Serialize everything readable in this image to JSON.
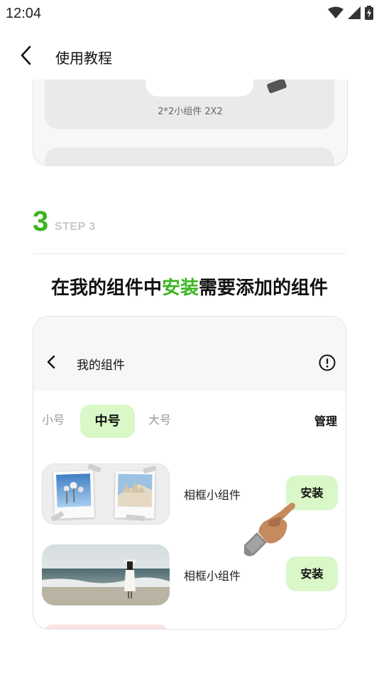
{
  "status_bar": {
    "time": "12:04",
    "icons": [
      "wifi-icon",
      "signal-icon",
      "battery-charging-icon"
    ]
  },
  "app_bar": {
    "back_icon": "chevron-left-icon",
    "title": "使用教程"
  },
  "prev_card": {
    "caption": "2*2小组件 2X2"
  },
  "step": {
    "number": "3",
    "label": "STEP 3",
    "headline_before": "在我的组件中",
    "headline_highlight": "安装",
    "headline_after": "需要添加的组件"
  },
  "demo_screen": {
    "title": "我的组件",
    "tabs": [
      {
        "label": "小号",
        "active": false
      },
      {
        "label": "中号",
        "active": true
      },
      {
        "label": "大号",
        "active": false
      }
    ],
    "manage_label": "管理",
    "widgets": [
      {
        "label": "相框小组件",
        "install_label": "安装"
      },
      {
        "label": "相框小组件",
        "install_label": "安装"
      }
    ]
  },
  "colors": {
    "accent": "#3cb51f",
    "button_bg": "#d9f7c7",
    "muted": "#c9c9c9"
  }
}
